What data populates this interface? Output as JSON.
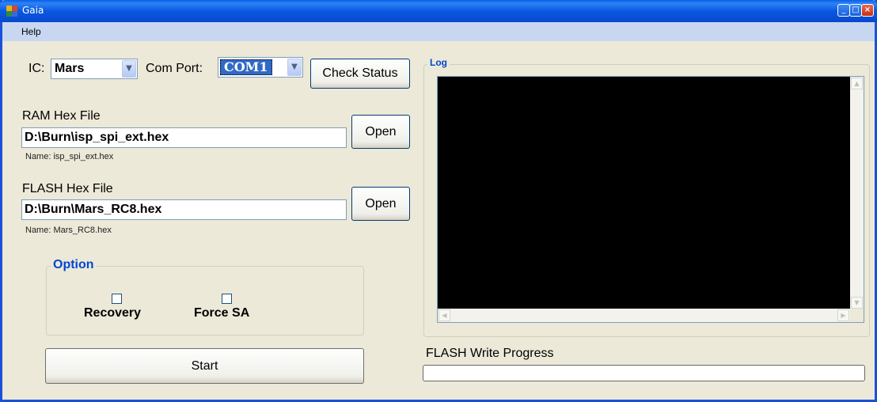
{
  "window": {
    "title": "Gaia"
  },
  "menu": {
    "help": "Help"
  },
  "ic": {
    "label": "IC:",
    "value": "Mars"
  },
  "com_port": {
    "label": "Com Port:",
    "value": "COM1"
  },
  "buttons": {
    "check_status": "Check Status",
    "open_ram": "Open",
    "open_flash": "Open",
    "start": "Start"
  },
  "ram": {
    "label": "RAM Hex File",
    "path": "D:\\Burn\\isp_spi_ext.hex",
    "name": "Name: isp_spi_ext.hex"
  },
  "flash": {
    "label": "FLASH Hex File",
    "path": "D:\\Burn\\Mars_RC8.hex",
    "name": "Name: Mars_RC8.hex"
  },
  "option": {
    "title": "Option",
    "recovery": "Recovery",
    "force_sa": "Force SA",
    "recovery_checked": false,
    "force_sa_checked": false
  },
  "log": {
    "title": "Log",
    "content": ""
  },
  "progress": {
    "label": "FLASH Write Progress",
    "fraction": 0
  },
  "colors": {
    "title_bar": "#0a58e0",
    "menu_bar": "#c8d7f1",
    "window_bg": "#ece9d8",
    "group_title": "#0046d5",
    "log_bg": "#000000",
    "selection": "#316ac5"
  }
}
